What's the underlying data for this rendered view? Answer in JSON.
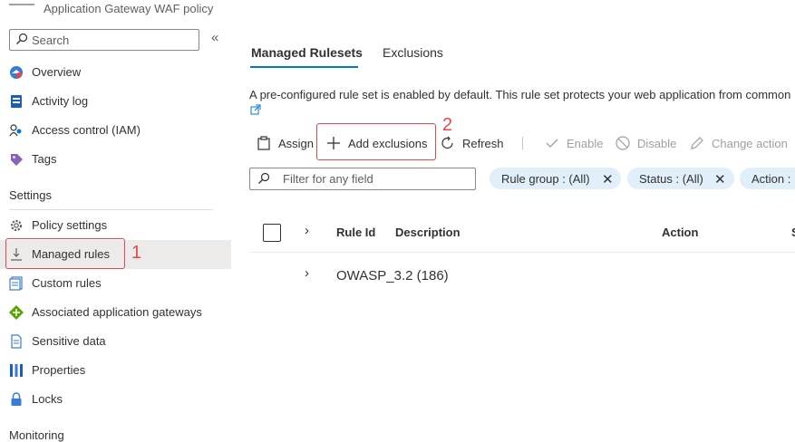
{
  "header": {
    "subtitle": "Application Gateway WAF policy"
  },
  "search": {
    "placeholder": "Search"
  },
  "sidebar": {
    "items": [
      {
        "label": "Overview"
      },
      {
        "label": "Activity log"
      },
      {
        "label": "Access control (IAM)"
      },
      {
        "label": "Tags"
      }
    ],
    "settings_header": "Settings",
    "settings_items": [
      {
        "label": "Policy settings"
      },
      {
        "label": "Managed rules"
      },
      {
        "label": "Custom rules"
      },
      {
        "label": "Associated application gateways"
      },
      {
        "label": "Sensitive data"
      },
      {
        "label": "Properties"
      },
      {
        "label": "Locks"
      }
    ],
    "monitoring_header": "Monitoring"
  },
  "annotations": {
    "step1": "1",
    "step2": "2",
    "color": "#e8474b"
  },
  "tabs": [
    {
      "label": "Managed Rulesets",
      "active": true
    },
    {
      "label": "Exclusions",
      "active": false
    }
  ],
  "description": "A pre-configured rule set is enabled by default. This rule set protects your web application from common",
  "toolbar": {
    "assign": "Assign",
    "add_exclusions": "Add exclusions",
    "refresh": "Refresh",
    "enable": "Enable",
    "disable": "Disable",
    "change_action": "Change action"
  },
  "filter": {
    "placeholder": "Filter for any field",
    "pills": [
      {
        "label": "Rule group : (All)"
      },
      {
        "label": "Status : (All)"
      },
      {
        "label": "Action :"
      }
    ]
  },
  "table": {
    "columns": [
      "Rule Id",
      "Description",
      "Action",
      "S"
    ],
    "rows": [
      {
        "label": "OWASP_3.2 (186)"
      }
    ]
  },
  "colors": {
    "accent": "#0078d4",
    "selected_bg": "#edebe9",
    "pill_bg": "#e1effa"
  }
}
